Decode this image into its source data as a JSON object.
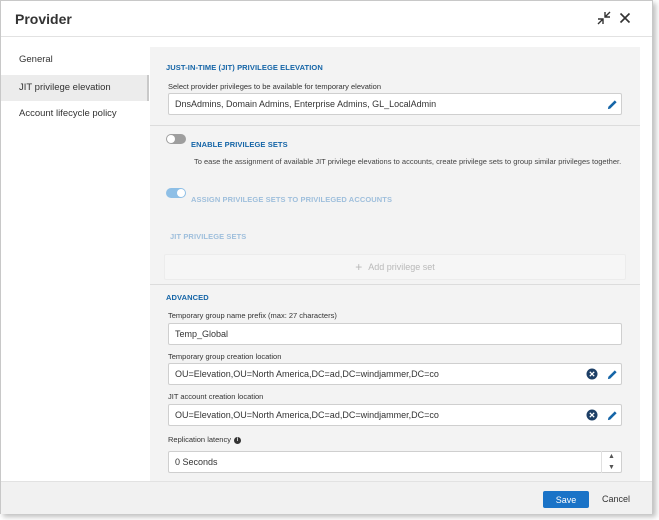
{
  "dialog": {
    "title": "Provider",
    "collapse_icon": "collapse-arrows-icon",
    "close_icon": "close-icon"
  },
  "sidebar": {
    "items": [
      {
        "label": "General"
      },
      {
        "label": "JIT privilege elevation",
        "active": true
      },
      {
        "label": "Account lifecycle policy"
      }
    ]
  },
  "jit": {
    "section_title": "JUST-IN-TIME (JIT) PRIVILEGE ELEVATION",
    "privileges_label": "Select provider privileges to be available for temporary elevation",
    "privileges_value": "DnsAdmins, Domain Admins, Enterprise Admins, GL_LocalAdmin",
    "enable_sets_label": "ENABLE PRIVILEGE SETS",
    "enable_sets_on": false,
    "enable_sets_desc": "To ease the assignment of available JIT privilege elevations to accounts, create privilege sets to group similar privileges together.",
    "assign_sets_label": "ASSIGN PRIVILEGE SETS TO PRIVILEGED ACCOUNTS",
    "assign_sets_on": true,
    "privilege_sets_title": "JIT PRIVILEGE SETS",
    "add_set_label": "Add privilege set"
  },
  "advanced": {
    "section_title": "ADVANCED",
    "prefix_label": "Temporary group name prefix (max: 27 characters)",
    "prefix_value": "Temp_Global",
    "group_location_label": "Temporary group creation location",
    "group_location_value": "OU=Elevation,OU=North America,DC=ad,DC=windjammer,DC=co",
    "account_location_label": "JIT account creation location",
    "account_location_value": "OU=Elevation,OU=North America,DC=ad,DC=windjammer,DC=co",
    "latency_label": "Replication latency",
    "latency_value": "0 Seconds"
  },
  "footer": {
    "save_label": "Save",
    "cancel_label": "Cancel"
  },
  "colors": {
    "accent": "#1565a7",
    "primary_button": "#1a73c7",
    "toggle_on": "#8ebfe6",
    "toggle_off": "#9e9e9e"
  }
}
